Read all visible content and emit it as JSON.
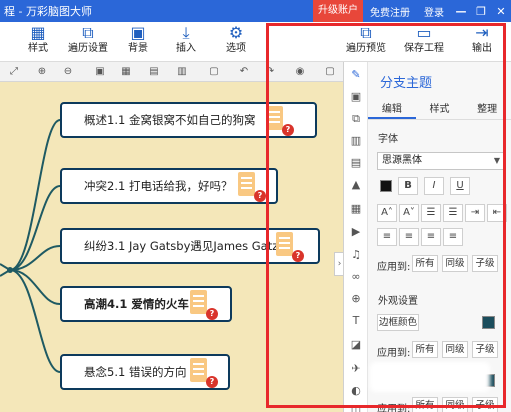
{
  "titlebar": {
    "title": "程 - 万彩脑图大师",
    "upgrade": "升级账户",
    "register": "免费注册",
    "login": "登录",
    "minimize": "—",
    "restore": "❐",
    "close": "✕"
  },
  "ribbon": {
    "style": "样式",
    "traverse": "遍历设置",
    "background": "背景",
    "insert": "插入",
    "options": "选项",
    "preview": "遍历预览",
    "save": "保存工程",
    "export": "输出"
  },
  "nodes": [
    {
      "label": "概述1.1 金窝银窝不如自己的狗窝",
      "bold": false
    },
    {
      "label": "冲突2.1 打电话给我，好吗？",
      "bold": false
    },
    {
      "label": "纠纷3.1 Jay Gatsby遇见James Gatz",
      "bold": false
    },
    {
      "label": "高潮4.1 爱情的火车",
      "bold": true
    },
    {
      "label": "悬念5.1 错误的方向",
      "bold": false
    }
  ],
  "note_badge": "?",
  "panel": {
    "title": "分支主题",
    "tabs": [
      "编辑",
      "样式",
      "整理"
    ],
    "font_section": "字体",
    "font_value": "思源黑体",
    "apply_to": "应用到:",
    "apply_all": "所有",
    "apply_same": "同级",
    "apply_child": "子级",
    "appearance_section": "外观设置",
    "border_color": "边框颜色"
  },
  "colors": {
    "titlebar": "#2b67d8",
    "accent": "#2b67d8",
    "annotation": "#e8282b",
    "canvas": "#f4e7b9",
    "node_border": "#0d3a5c",
    "note": "#f9c882",
    "badge": "#d9342b",
    "branch": "#1e5a63"
  }
}
